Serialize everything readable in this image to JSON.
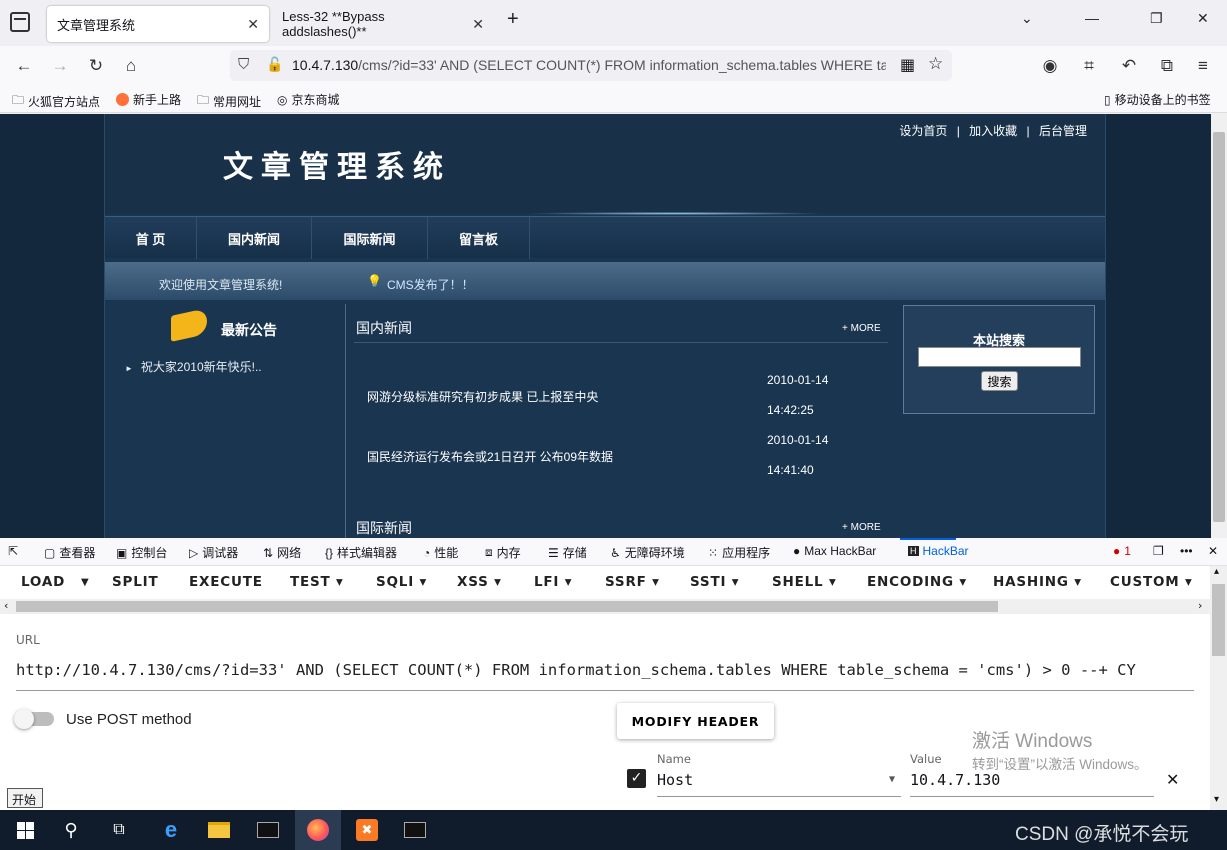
{
  "browser": {
    "tabs": [
      {
        "title": "文章管理系统",
        "active": true
      },
      {
        "title": "Less-32 **Bypass addslashes()**",
        "active": false
      }
    ],
    "url_host": "10.4.7.130",
    "url_rest": "/cms/?id=33' AND (SELECT COUNT(*) FROM information_schema.tables WHERE table_schema = 'cms') > 0 --+",
    "bookmarks": [
      "火狐官方站点",
      "新手上路",
      "常用网址",
      "京东商城"
    ],
    "mobile_bookmarks": "移动设备上的书签"
  },
  "site": {
    "logo": "文章管理系统",
    "top_links": [
      "设为首页",
      "加入收藏",
      "后台管理"
    ],
    "menu": [
      "首 页",
      "国内新闻",
      "国际新闻",
      "留言板"
    ],
    "welcome": "欢迎使用文章管理系统!",
    "announce_flash": "CMS发布了！！",
    "notice_title": "最新公告",
    "notice_items": [
      "祝大家2010新年快乐!.."
    ],
    "domestic_title": "国内新闻",
    "more": "+ MORE",
    "domestic_news": [
      {
        "title": "网游分级标准研究有初步成果 已上报至中央",
        "date": "2010-01-14",
        "time": "14:42:25"
      },
      {
        "title": "国民经济运行发布会或21日召开 公布09年数据",
        "date": "2010-01-14",
        "time": "14:41:40"
      }
    ],
    "international_title": "国际新闻",
    "search_title": "本站搜索",
    "search_button": "搜索",
    "search_value": ""
  },
  "devtools": {
    "tabs": [
      "查看器",
      "控制台",
      "调试器",
      "网络",
      "样式编辑器",
      "性能",
      "内存",
      "存储",
      "无障碍环境",
      "应用程序",
      "Max HackBar",
      "HackBar"
    ],
    "error_count": "1"
  },
  "hackbar": {
    "menu": [
      "LOAD",
      "SPLIT",
      "EXECUTE",
      "TEST",
      "SQLI",
      "XSS",
      "LFI",
      "SSRF",
      "SSTI",
      "SHELL",
      "ENCODING",
      "HASHING",
      "CUSTOM"
    ],
    "url_label": "URL",
    "url_value": "http://10.4.7.130/cms/?id=33' AND (SELECT COUNT(*) FROM information_schema.tables WHERE table_schema = 'cms') > 0 --+ CY",
    "post_label": "Use POST method",
    "modify_header": "MODIFY HEADER",
    "header_name_label": "Name",
    "header_name": "Host",
    "header_value_label": "Value",
    "header_value": "10.4.7.130"
  },
  "overlay": {
    "activate_title": "激活 Windows",
    "activate_sub": "转到“设置”以激活 Windows。",
    "start_tip": "开始",
    "watermark": "CSDN @承悦不会玩"
  }
}
